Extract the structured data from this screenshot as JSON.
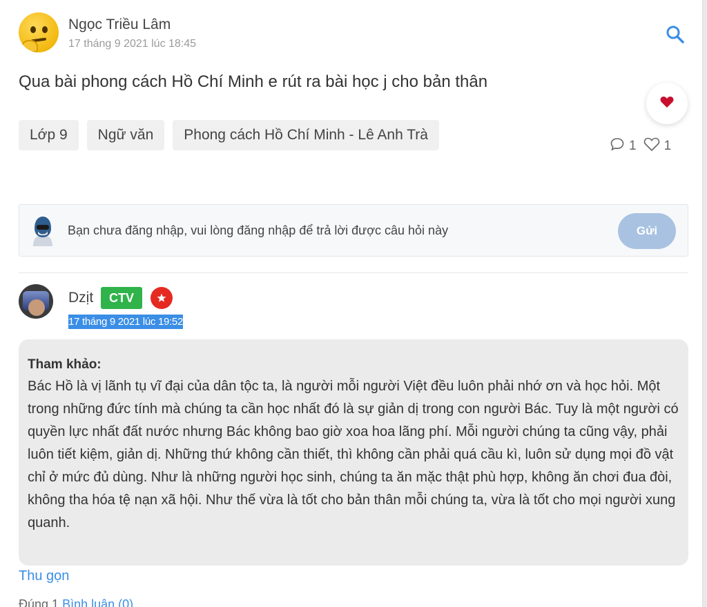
{
  "post": {
    "author": "Ngọc Triều Lâm",
    "time": "17 tháng 9 2021 lúc 18:45",
    "question": "Qua bài phong cách Hồ Chí Minh e rút ra bài học j cho bản thân",
    "tags": [
      "Lớp 9",
      "Ngữ văn",
      "Phong cách Hồ Chí Minh - Lê Anh Trà"
    ],
    "comments_count": "1",
    "likes_count": "1"
  },
  "login_prompt": {
    "text": "Bạn chưa đăng nhập, vui lòng đăng nhập để trả lời được câu hỏi này",
    "send_label": "Gửi"
  },
  "answer": {
    "author": "Dzịt",
    "badge": "CTV",
    "time": "17 tháng 9 2021 lúc 19:52",
    "heading": "Tham khảo:",
    "body": "Bác Hồ là vị lãnh tụ vĩ đại của dân tộc ta, là người mỗi người Việt đều luôn phải nhớ ơn và học hỏi. Một trong những đức tính mà chúng ta cần học nhất đó là sự giản dị trong con người Bác. Tuy là một người có quyền lực nhất đất nước nhưng Bác không bao giờ xoa hoa lãng phí. Mỗi người chúng ta cũng vậy, phải luôn tiết kiệm, giản dị. Những thứ không cần thiết, thì không cần phải quá cầu kì, luôn sử dụng mọi đồ vật chỉ ở mức đủ dùng. Như là những người học sinh, chúng ta ăn mặc thật phù hợp, không ăn chơi đua đòi, không tha hóa tệ nạn xã hội. Như thế vừa là tốt cho bản thân mỗi chúng ta, vừa là tốt cho mọi người xung quanh.",
    "collapse_label": "Thu gọn",
    "footer_left": "Đúng 1",
    "footer_link": "Bình luận (0)"
  },
  "icons": {
    "search": "search-icon",
    "favorite": "heart-icon",
    "comment": "comment-icon",
    "like": "heart-outline-icon",
    "guest": "hacker-avatar-icon",
    "star": "star-icon"
  },
  "colors": {
    "accent": "#3a8ee6",
    "send_button": "#a9c2e2",
    "ctv_badge": "#2fb34a",
    "star_badge": "#e52a22",
    "favorite_heart": "#c8102e",
    "answer_bg": "#ebebeb"
  }
}
